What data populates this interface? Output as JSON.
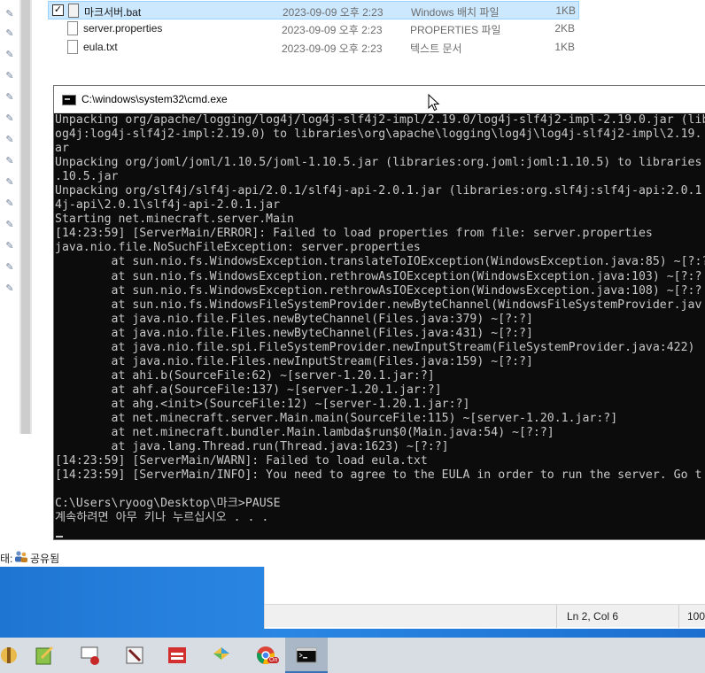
{
  "explorer": {
    "files": [
      {
        "name": "마크서버.bat",
        "date": "2023-09-09 오후 2:23",
        "type": "Windows 배치 파일",
        "size": "1KB",
        "selected": true
      },
      {
        "name": "server.properties",
        "date": "2023-09-09 오후 2:23",
        "type": "PROPERTIES 파일",
        "size": "2KB",
        "selected": false
      },
      {
        "name": "eula.txt",
        "date": "2023-09-09 오후 2:23",
        "type": "텍스트 문서",
        "size": "1KB",
        "selected": false
      }
    ],
    "pin_icon": "pin-icon",
    "status": {
      "label": "태:",
      "value": "공유됨",
      "icon": "share-users-icon"
    }
  },
  "cmd": {
    "title": "C:\\windows\\system32\\cmd.exe",
    "lines": [
      "Unpacking org/apache/logging/log4j/log4j-slf4j2-impl/2.19.0/log4j-slf4j2-impl-2.19.0.jar (lib",
      "og4j:log4j-slf4j2-impl:2.19.0) to libraries\\org\\apache\\logging\\log4j\\log4j-slf4j2-impl\\2.19.",
      "ar",
      "Unpacking org/joml/joml/1.10.5/joml-1.10.5.jar (libraries:org.joml:joml:1.10.5) to libraries",
      ".10.5.jar",
      "Unpacking org/slf4j/slf4j-api/2.0.1/slf4j-api-2.0.1.jar (libraries:org.slf4j:slf4j-api:2.0.1",
      "4j-api\\2.0.1\\slf4j-api-2.0.1.jar",
      "Starting net.minecraft.server.Main",
      "[14:23:59] [ServerMain/ERROR]: Failed to load properties from file: server.properties",
      "java.nio.file.NoSuchFileException: server.properties",
      "        at sun.nio.fs.WindowsException.translateToIOException(WindowsException.java:85) ~[?:?",
      "        at sun.nio.fs.WindowsException.rethrowAsIOException(WindowsException.java:103) ~[?:?",
      "        at sun.nio.fs.WindowsException.rethrowAsIOException(WindowsException.java:108) ~[?:?",
      "        at sun.nio.fs.WindowsFileSystemProvider.newByteChannel(WindowsFileSystemProvider.jav",
      "        at java.nio.file.Files.newByteChannel(Files.java:379) ~[?:?]",
      "        at java.nio.file.Files.newByteChannel(Files.java:431) ~[?:?]",
      "        at java.nio.file.spi.FileSystemProvider.newInputStream(FileSystemProvider.java:422)",
      "        at java.nio.file.Files.newInputStream(Files.java:159) ~[?:?]",
      "        at ahi.b(SourceFile:62) ~[server-1.20.1.jar:?]",
      "        at ahf.a(SourceFile:137) ~[server-1.20.1.jar:?]",
      "        at ahg.<init>(SourceFile:12) ~[server-1.20.1.jar:?]",
      "        at net.minecraft.server.Main.main(SourceFile:115) ~[server-1.20.1.jar:?]",
      "        at net.minecraft.bundler.Main.lambda$run$0(Main.java:54) ~[?:?]",
      "        at java.lang.Thread.run(Thread.java:1623) ~[?:?]",
      "[14:23:59] [ServerMain/WARN]: Failed to load eula.txt",
      "[14:23:59] [ServerMain/INFO]: You need to agree to the EULA in order to run the server. Go t",
      "",
      "C:\\Users\\ryoog\\Desktop\\마크>PAUSE",
      "계속하려면 아무 키나 누르십시오 . . ."
    ]
  },
  "notepad": {
    "position": "Ln 2, Col 6",
    "zoom": "100"
  },
  "taskbar": {
    "items": [
      {
        "icon": "setup-wizard-icon",
        "active": false
      },
      {
        "icon": "notepad-plus-icon",
        "active": false
      },
      {
        "icon": "screen-recorder-icon",
        "active": false
      },
      {
        "icon": "paint-tool-icon",
        "active": false
      },
      {
        "icon": "red-app-icon",
        "active": false
      },
      {
        "icon": "windows-logo-icon",
        "active": false
      },
      {
        "icon": "chrome-icon",
        "active": false,
        "badge": "On"
      },
      {
        "icon": "cmd-icon",
        "active": true
      }
    ]
  }
}
